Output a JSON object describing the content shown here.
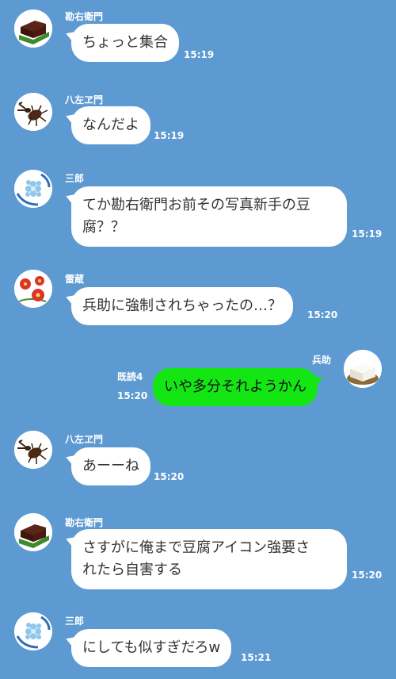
{
  "colors": {
    "background": "#5d9ad2",
    "bubble_incoming": "#ffffff",
    "bubble_outgoing": "#14e614"
  },
  "messages": [
    {
      "sender": "勘右衛門",
      "text": "ちょっと集合",
      "time": "15:19",
      "avatar": "yokan-icon"
    },
    {
      "sender": "八左ヱ門",
      "text": "なんだよ",
      "time": "15:19",
      "avatar": "beetle-icon"
    },
    {
      "sender": "三郎",
      "text": "てか勘右衛門お前その写真新手の豆\n腐？？",
      "time": "15:19",
      "avatar": "hydrangea-icon"
    },
    {
      "sender": "雷蔵",
      "text": "兵助に強制されちゃったの…？",
      "time": "15:20",
      "avatar": "flowers-icon"
    },
    {
      "sender": "兵助",
      "text": "いや多分それようかん",
      "time": "15:20",
      "read": "既読4",
      "avatar": "tofu-icon"
    },
    {
      "sender": "八左ヱ門",
      "text": "あーーね",
      "time": "15:20",
      "avatar": "beetle-icon"
    },
    {
      "sender": "勘右衛門",
      "text": "さすがに俺まで豆腐アイコン強要さ\nれたら自害する",
      "time": "15:20",
      "avatar": "yokan-icon"
    },
    {
      "sender": "三郎",
      "text": "にしても似すぎだろw",
      "time": "15:21",
      "avatar": "hydrangea-icon"
    }
  ]
}
